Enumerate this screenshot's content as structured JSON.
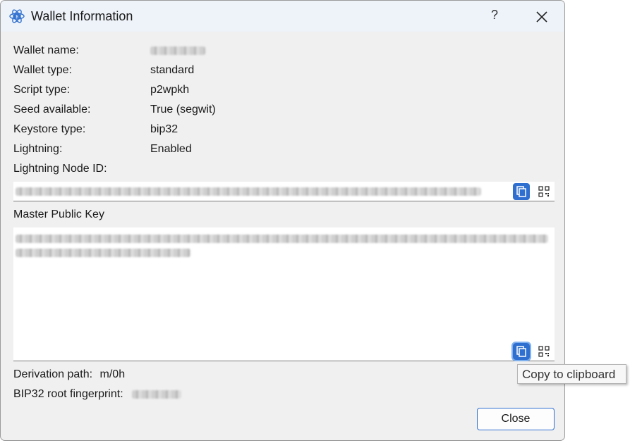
{
  "window": {
    "title": "Wallet Information",
    "help_label": "?"
  },
  "details": [
    {
      "label": "Wallet name:",
      "value": ""
    },
    {
      "label": "Wallet type:",
      "value": "standard"
    },
    {
      "label": "Script type:",
      "value": "p2wpkh"
    },
    {
      "label": "Seed available:",
      "value": "True (segwit)"
    },
    {
      "label": "Keystore type:",
      "value": "bip32"
    },
    {
      "label": "Lightning:",
      "value": "Enabled"
    }
  ],
  "lightning_node": {
    "label": "Lightning Node ID:"
  },
  "master_public_key": {
    "label": "Master Public Key"
  },
  "derivation": {
    "label": "Derivation path:",
    "value": "m/0h"
  },
  "fingerprint": {
    "label": "BIP32 root fingerprint:"
  },
  "tooltip": {
    "text": "Copy to clipboard"
  },
  "close_button": {
    "label": "Close"
  },
  "colors": {
    "accent": "#2f6fcf",
    "titlebar": "#eef3f9",
    "body": "#f0f0f0"
  },
  "icons": [
    "electrum-logo-icon",
    "help-icon",
    "close-icon",
    "copy-icon",
    "qr-code-icon"
  ]
}
